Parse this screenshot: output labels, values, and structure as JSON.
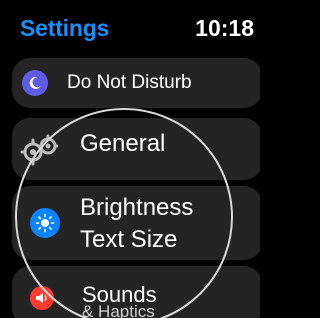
{
  "header": {
    "title": "Settings",
    "time": "10:18"
  },
  "settings_items": [
    {
      "label": "Do Not Disturb",
      "icon": "moon-icon",
      "icon_color": "#5e5ce6"
    },
    {
      "label": "General",
      "icon": "gear-icon",
      "icon_color": "#8e8e93"
    },
    {
      "label_line1": "Brightness",
      "label_line2": "Text Size",
      "icon": "sun-icon",
      "icon_color": "#0a84ff"
    },
    {
      "label_line1": "Sounds",
      "label_line2": "& Haptics",
      "icon": "speaker-icon",
      "icon_color": "#ff3b30"
    }
  ],
  "colors": {
    "title": "#1e8ef7",
    "row_background": "#242424",
    "background": "#000000"
  }
}
